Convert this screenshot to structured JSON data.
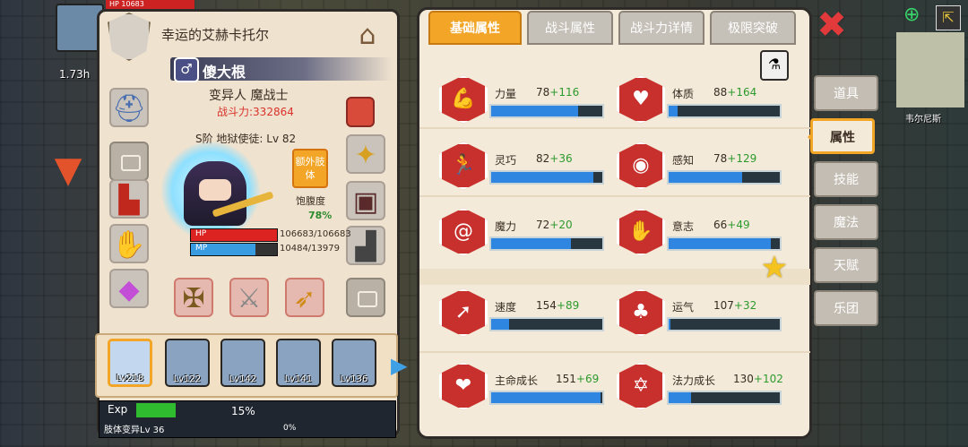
{
  "hud": {
    "hp_label": "HP",
    "hp_value": "10683",
    "time": "1.73h"
  },
  "character": {
    "title": "幸运的艾赫卡托尔",
    "name": "傻大根",
    "gender_icon": "♂",
    "class": "变异人 魔战士",
    "power": "战斗力:332864",
    "level": "S阶 地狱使徒: Lv 82",
    "extra_limb_btn": "额外肢体",
    "satiety_label": "饱腹度",
    "satiety_value": "78%",
    "satiety": 0.78,
    "hp_label": "HP",
    "hp_value": "106683/106683",
    "mp_label": "MP",
    "mp_value": "10484/13979",
    "hp_fill": 1.0,
    "mp_fill": 0.75
  },
  "party": [
    {
      "lv": "Lv218",
      "selected": true
    },
    {
      "lv": "Lv122",
      "selected": false
    },
    {
      "lv": "Lv142",
      "selected": false
    },
    {
      "lv": "Lv141",
      "selected": false
    },
    {
      "lv": "Lv136",
      "selected": false
    }
  ],
  "exp": {
    "label": "Exp",
    "percent": "15%",
    "fill": 0.15,
    "body_label": "肢体变异Lv 36",
    "body_percent": "0%"
  },
  "tabs": [
    "基础属性",
    "战斗属性",
    "战斗力详情",
    "极限突破"
  ],
  "stats": [
    {
      "name": "力量",
      "base": "78",
      "bonus": "+116",
      "fill": 0.78,
      "icon": "arm-icon"
    },
    {
      "name": "体质",
      "base": "88",
      "bonus": "+164",
      "fill": 0.08,
      "icon": "body-icon"
    },
    {
      "name": "灵巧",
      "base": "82",
      "bonus": "+36",
      "fill": 0.92,
      "icon": "runner-icon"
    },
    {
      "name": "感知",
      "base": "78",
      "bonus": "+129",
      "fill": 0.66,
      "icon": "eye-icon"
    },
    {
      "name": "魔力",
      "base": "72",
      "bonus": "+20",
      "fill": 0.72,
      "icon": "swirl-icon"
    },
    {
      "name": "意志",
      "base": "66",
      "bonus": "+49",
      "fill": 0.92,
      "icon": "will-icon"
    },
    {
      "name": "速度",
      "base": "154",
      "bonus": "+89",
      "fill": 0.16,
      "icon": "speed-icon"
    },
    {
      "name": "运气",
      "base": "107",
      "bonus": "+32",
      "fill": 0.02,
      "icon": "clover-icon"
    },
    {
      "name": "主命成长",
      "base": "151",
      "bonus": "+69",
      "fill": 0.98,
      "icon": "heart-icon"
    },
    {
      "name": "法力成长",
      "base": "130",
      "bonus": "+102",
      "fill": 0.2,
      "icon": "star-pentagram-icon"
    }
  ],
  "menu": [
    {
      "label": "道具",
      "active": false
    },
    {
      "label": "属性",
      "active": true
    },
    {
      "label": "技能",
      "active": false
    },
    {
      "label": "魔法",
      "active": false
    },
    {
      "label": "天赋",
      "active": false
    },
    {
      "label": "乐团",
      "active": false
    }
  ],
  "map_label": "韦尔尼斯",
  "colors": {
    "accent": "#f2a526",
    "stat_red": "#c7302c",
    "bar_blue": "#2f86e0",
    "bonus_green": "#2d9a2d"
  }
}
